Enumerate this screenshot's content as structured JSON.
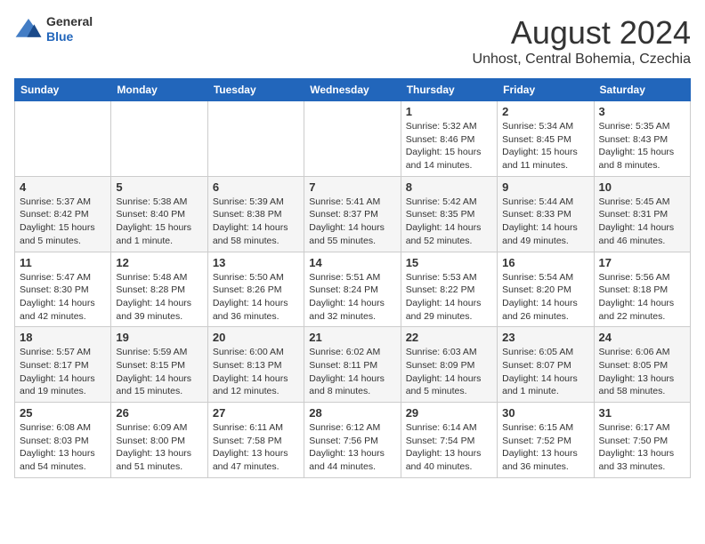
{
  "header": {
    "logo_general": "General",
    "logo_blue": "Blue",
    "month_year": "August 2024",
    "location": "Unhost, Central Bohemia, Czechia"
  },
  "weekdays": [
    "Sunday",
    "Monday",
    "Tuesday",
    "Wednesday",
    "Thursday",
    "Friday",
    "Saturday"
  ],
  "weeks": [
    [
      {
        "day": "",
        "info": ""
      },
      {
        "day": "",
        "info": ""
      },
      {
        "day": "",
        "info": ""
      },
      {
        "day": "",
        "info": ""
      },
      {
        "day": "1",
        "info": "Sunrise: 5:32 AM\nSunset: 8:46 PM\nDaylight: 15 hours\nand 14 minutes."
      },
      {
        "day": "2",
        "info": "Sunrise: 5:34 AM\nSunset: 8:45 PM\nDaylight: 15 hours\nand 11 minutes."
      },
      {
        "day": "3",
        "info": "Sunrise: 5:35 AM\nSunset: 8:43 PM\nDaylight: 15 hours\nand 8 minutes."
      }
    ],
    [
      {
        "day": "4",
        "info": "Sunrise: 5:37 AM\nSunset: 8:42 PM\nDaylight: 15 hours\nand 5 minutes."
      },
      {
        "day": "5",
        "info": "Sunrise: 5:38 AM\nSunset: 8:40 PM\nDaylight: 15 hours\nand 1 minute."
      },
      {
        "day": "6",
        "info": "Sunrise: 5:39 AM\nSunset: 8:38 PM\nDaylight: 14 hours\nand 58 minutes."
      },
      {
        "day": "7",
        "info": "Sunrise: 5:41 AM\nSunset: 8:37 PM\nDaylight: 14 hours\nand 55 minutes."
      },
      {
        "day": "8",
        "info": "Sunrise: 5:42 AM\nSunset: 8:35 PM\nDaylight: 14 hours\nand 52 minutes."
      },
      {
        "day": "9",
        "info": "Sunrise: 5:44 AM\nSunset: 8:33 PM\nDaylight: 14 hours\nand 49 minutes."
      },
      {
        "day": "10",
        "info": "Sunrise: 5:45 AM\nSunset: 8:31 PM\nDaylight: 14 hours\nand 46 minutes."
      }
    ],
    [
      {
        "day": "11",
        "info": "Sunrise: 5:47 AM\nSunset: 8:30 PM\nDaylight: 14 hours\nand 42 minutes."
      },
      {
        "day": "12",
        "info": "Sunrise: 5:48 AM\nSunset: 8:28 PM\nDaylight: 14 hours\nand 39 minutes."
      },
      {
        "day": "13",
        "info": "Sunrise: 5:50 AM\nSunset: 8:26 PM\nDaylight: 14 hours\nand 36 minutes."
      },
      {
        "day": "14",
        "info": "Sunrise: 5:51 AM\nSunset: 8:24 PM\nDaylight: 14 hours\nand 32 minutes."
      },
      {
        "day": "15",
        "info": "Sunrise: 5:53 AM\nSunset: 8:22 PM\nDaylight: 14 hours\nand 29 minutes."
      },
      {
        "day": "16",
        "info": "Sunrise: 5:54 AM\nSunset: 8:20 PM\nDaylight: 14 hours\nand 26 minutes."
      },
      {
        "day": "17",
        "info": "Sunrise: 5:56 AM\nSunset: 8:18 PM\nDaylight: 14 hours\nand 22 minutes."
      }
    ],
    [
      {
        "day": "18",
        "info": "Sunrise: 5:57 AM\nSunset: 8:17 PM\nDaylight: 14 hours\nand 19 minutes."
      },
      {
        "day": "19",
        "info": "Sunrise: 5:59 AM\nSunset: 8:15 PM\nDaylight: 14 hours\nand 15 minutes."
      },
      {
        "day": "20",
        "info": "Sunrise: 6:00 AM\nSunset: 8:13 PM\nDaylight: 14 hours\nand 12 minutes."
      },
      {
        "day": "21",
        "info": "Sunrise: 6:02 AM\nSunset: 8:11 PM\nDaylight: 14 hours\nand 8 minutes."
      },
      {
        "day": "22",
        "info": "Sunrise: 6:03 AM\nSunset: 8:09 PM\nDaylight: 14 hours\nand 5 minutes."
      },
      {
        "day": "23",
        "info": "Sunrise: 6:05 AM\nSunset: 8:07 PM\nDaylight: 14 hours\nand 1 minute."
      },
      {
        "day": "24",
        "info": "Sunrise: 6:06 AM\nSunset: 8:05 PM\nDaylight: 13 hours\nand 58 minutes."
      }
    ],
    [
      {
        "day": "25",
        "info": "Sunrise: 6:08 AM\nSunset: 8:03 PM\nDaylight: 13 hours\nand 54 minutes."
      },
      {
        "day": "26",
        "info": "Sunrise: 6:09 AM\nSunset: 8:00 PM\nDaylight: 13 hours\nand 51 minutes."
      },
      {
        "day": "27",
        "info": "Sunrise: 6:11 AM\nSunset: 7:58 PM\nDaylight: 13 hours\nand 47 minutes."
      },
      {
        "day": "28",
        "info": "Sunrise: 6:12 AM\nSunset: 7:56 PM\nDaylight: 13 hours\nand 44 minutes."
      },
      {
        "day": "29",
        "info": "Sunrise: 6:14 AM\nSunset: 7:54 PM\nDaylight: 13 hours\nand 40 minutes."
      },
      {
        "day": "30",
        "info": "Sunrise: 6:15 AM\nSunset: 7:52 PM\nDaylight: 13 hours\nand 36 minutes."
      },
      {
        "day": "31",
        "info": "Sunrise: 6:17 AM\nSunset: 7:50 PM\nDaylight: 13 hours\nand 33 minutes."
      }
    ]
  ]
}
